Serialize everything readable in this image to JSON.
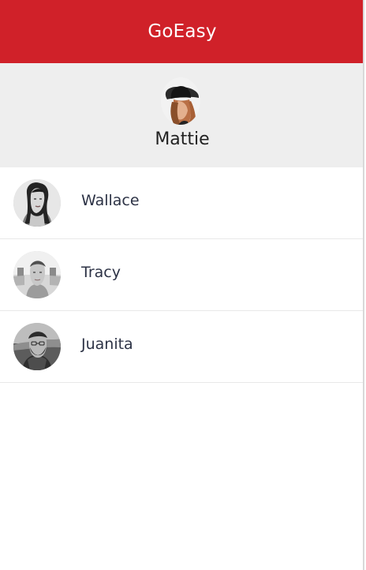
{
  "header": {
    "title": "GoEasy"
  },
  "current_user": {
    "name": "Mattie",
    "avatar_icon": "user-avatar-hat"
  },
  "contacts": [
    {
      "name": "Wallace",
      "avatar_icon": "user-avatar-wallace"
    },
    {
      "name": "Tracy",
      "avatar_icon": "user-avatar-tracy"
    },
    {
      "name": "Juanita",
      "avatar_icon": "user-avatar-juanita"
    }
  ],
  "colors": {
    "header_bg": "#d02129",
    "profile_bg": "#eeeeee",
    "text_primary": "#2c3245",
    "separator": "#e8e8e8"
  }
}
